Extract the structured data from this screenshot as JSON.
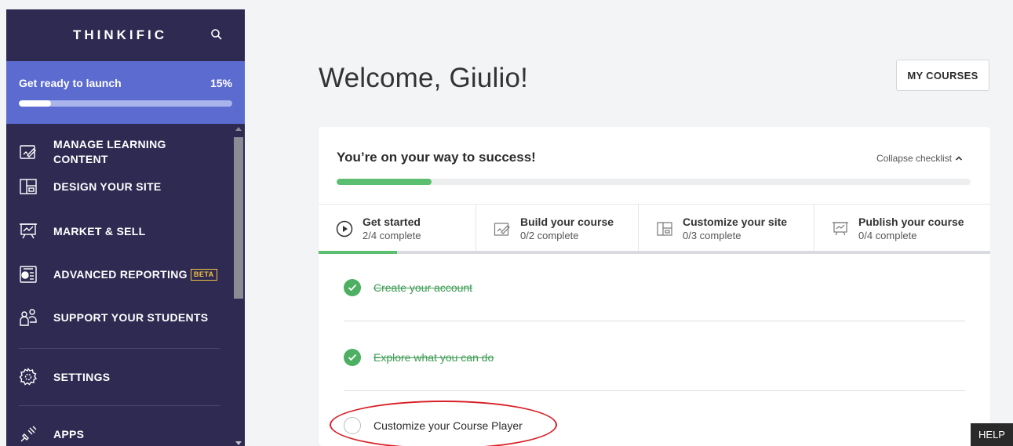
{
  "sidebar": {
    "brand": "THINKIFIC",
    "launch": {
      "label": "Get ready to launch",
      "percent_text": "15%",
      "progress": 0.15
    },
    "items": [
      {
        "label": "MANAGE LEARNING CONTENT",
        "icon": "manage-content-icon"
      },
      {
        "label": "DESIGN YOUR SITE",
        "icon": "layout-icon"
      },
      {
        "label": "MARKET & SELL",
        "icon": "presentation-chart-icon"
      },
      {
        "label": "ADVANCED REPORTING",
        "badge": "BETA",
        "icon": "reporting-icon"
      },
      {
        "label": "SUPPORT YOUR STUDENTS",
        "icon": "students-icon"
      },
      {
        "label": "SETTINGS",
        "icon": "gear-icon"
      },
      {
        "label": "APPS",
        "icon": "plug-icon"
      }
    ]
  },
  "main": {
    "welcome": "Welcome, Giulio!",
    "my_courses": "MY COURSES"
  },
  "checklist": {
    "title": "You’re on your way to success!",
    "collapse_label": "Collapse checklist",
    "progress": 0.15,
    "tabs": [
      {
        "title": "Get started",
        "sub": "2/4 complete",
        "icon": "play-circle-icon"
      },
      {
        "title": "Build your course",
        "sub": "0/2 complete",
        "icon": "edit-icon"
      },
      {
        "title": "Customize your site",
        "sub": "0/3 complete",
        "icon": "layout-icon"
      },
      {
        "title": "Publish your course",
        "sub": "0/4 complete",
        "icon": "presentation-chart-icon"
      }
    ],
    "tasks": [
      {
        "label": "Create your account",
        "done": true
      },
      {
        "label": "Explore what you can do",
        "done": true
      },
      {
        "label": "Customize your Course Player",
        "done": false
      }
    ]
  },
  "help_label": "HELP",
  "colors": {
    "sidebar_bg": "#2e2a52",
    "launch_bg": "#5b6bd0",
    "success_green": "#4caf61",
    "progress_green": "#5bbf6f",
    "highlight_red": "#d81f26"
  }
}
